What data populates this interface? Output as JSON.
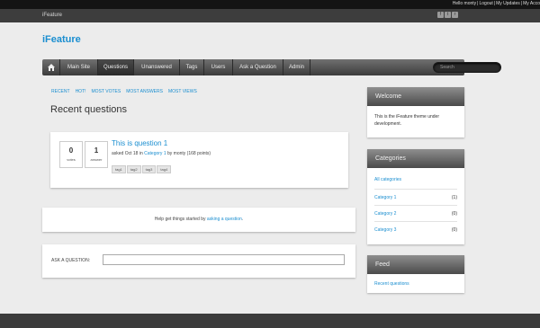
{
  "userbar": {
    "links": [
      "Hello monty",
      "Logout",
      "My Updates",
      "My Acco"
    ]
  },
  "topbar": {
    "site_name": "iFeature",
    "social": [
      "f",
      "t",
      "r"
    ]
  },
  "logo": "iFeature",
  "nav": {
    "items": [
      "Main Site",
      "Questions",
      "Unanswered",
      "Tags",
      "Users",
      "Ask a Question",
      "Admin"
    ],
    "active": "Questions",
    "search_placeholder": "Search"
  },
  "subtabs": [
    "RECENT",
    "HOT!",
    "MOST VOTES",
    "MOST ANSWERS",
    "MOST VIEWS"
  ],
  "page_title": "Recent questions",
  "question": {
    "votes": "0",
    "votes_label": "votes",
    "answers": "1",
    "answers_label": "answer",
    "title": "This is question 1",
    "meta_prefix": "asked Oct 18 in",
    "category": "Category 1",
    "meta_suffix": "by monty (168 points)",
    "tags": [
      "tag1",
      "tag2",
      "tag3",
      "tag4"
    ]
  },
  "help": {
    "prefix": "Help get things started by",
    "link": "asking a question",
    "suffix": "."
  },
  "ask": {
    "label": "ASK A QUESTION:"
  },
  "widgets": {
    "welcome": {
      "title": "Welcome",
      "text": "This is the iFeature theme under development."
    },
    "categories": {
      "title": "Categories",
      "all": "All categories",
      "items": [
        {
          "name": "Category 1",
          "count": "(1)"
        },
        {
          "name": "Category 2",
          "count": "(0)"
        },
        {
          "name": "Category 3",
          "count": "(0)"
        }
      ]
    },
    "feed": {
      "title": "Feed",
      "link": "Recent questions"
    }
  }
}
